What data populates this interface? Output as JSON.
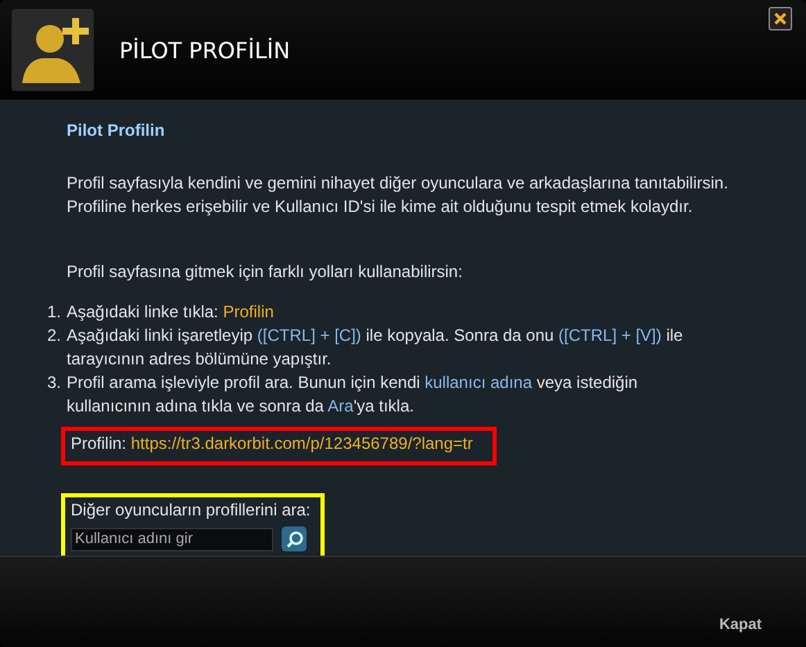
{
  "window": {
    "title": "PİLOT PROFİLİN"
  },
  "section_title": "Pilot Profilin",
  "intro": "Profil sayfasıyla kendini ve gemini nihayet diğer oyunculara ve arkadaşlarına tanıtabilirsin. Profiline herkes erişebilir ve Kullanıcı ID'si ile kime ait olduğunu tespit etmek kolaydır.",
  "ways_heading": "Profil sayfasına gitmek için farklı yolları kullanabilirsin:",
  "steps": [
    {
      "number": "1.",
      "parts": [
        {
          "kind": "plain",
          "text": "Aşağıdaki linke tıkla: "
        },
        {
          "kind": "link",
          "text": "Profilin"
        }
      ]
    },
    {
      "number": "2.",
      "parts": [
        {
          "kind": "plain",
          "text": "Aşağıdaki linki işaretleyip "
        },
        {
          "kind": "key",
          "text": "([CTRL] + [C])"
        },
        {
          "kind": "plain",
          "text": " ile kopyala. Sonra da onu "
        },
        {
          "kind": "key",
          "text": "([CTRL] + [V])"
        },
        {
          "kind": "plain",
          "text": " ile tarayıcının adres bölümüne yapıştır."
        }
      ]
    },
    {
      "number": "3.",
      "parts": [
        {
          "kind": "plain",
          "text": "Profil arama işleviyle profil ara. Bunun için kendi "
        },
        {
          "kind": "key",
          "text": "kullanıcı adına"
        },
        {
          "kind": "plain",
          "text": " veya istediğin kullanıcının adına tıkla ve sonra da "
        },
        {
          "kind": "key",
          "text": "Ara"
        },
        {
          "kind": "plain",
          "text": "'ya tıkla."
        }
      ]
    }
  ],
  "profile_link": {
    "label": "Profilin:",
    "url": "https://tr3.darkorbit.com/p/123456789/?lang=tr"
  },
  "search": {
    "label": "Diğer oyuncuların profillerini ara:",
    "placeholder": "Kullanıcı adını gir"
  },
  "close_button": "Kapat"
}
